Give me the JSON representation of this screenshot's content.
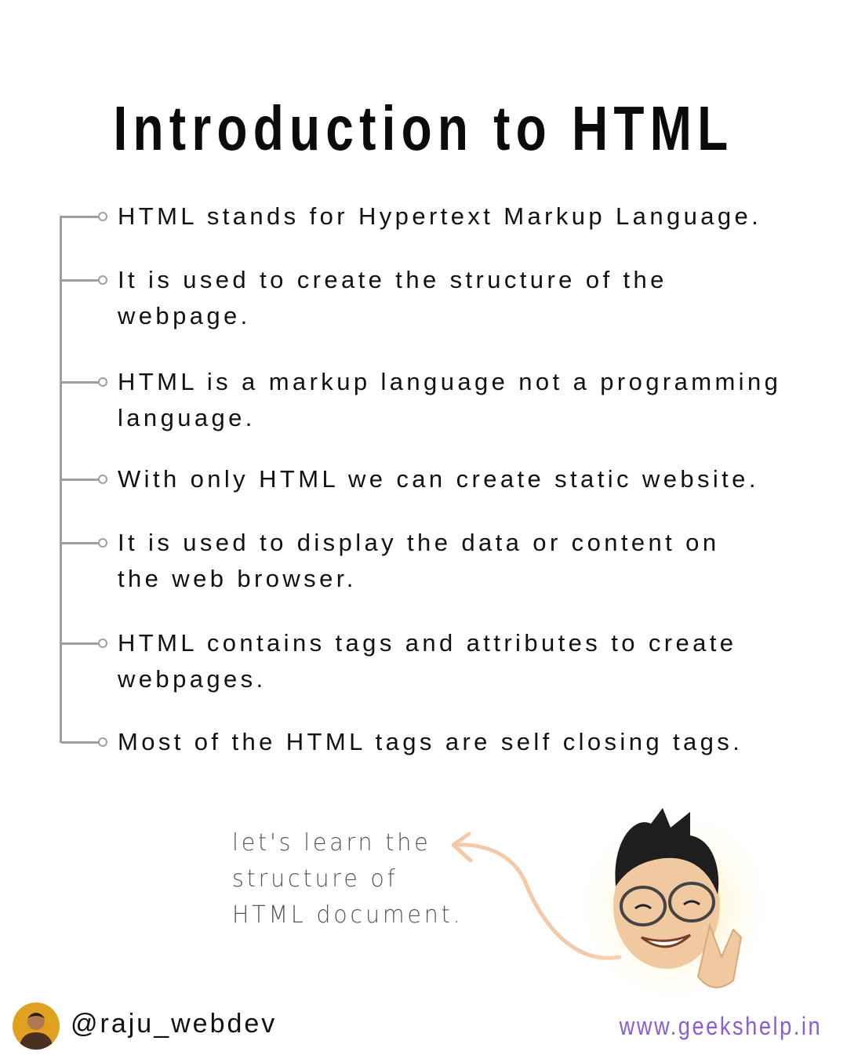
{
  "title": "Introduction to HTML",
  "points": [
    [
      "HTML stands for Hypertext Markup Language."
    ],
    [
      "It is used to create the structure of the",
      "webpage."
    ],
    [
      "HTML is a markup language not a programming",
      "language."
    ],
    [
      "With only HTML we can create static website."
    ],
    [
      "It is used to display the data or content on",
      "the web browser."
    ],
    [
      "HTML contains tags and attributes to create",
      "webpages."
    ],
    [
      "Most of the HTML tags are self closing tags."
    ]
  ],
  "note": [
    "let's learn the",
    "structure of",
    "HTML document."
  ],
  "footer": {
    "handle": "@raju_webdev",
    "website": "www.geekshelp.in"
  },
  "colors": {
    "accent": "#8a5cd6",
    "timeline": "#9e9e9e",
    "arrow": "#f5c9a8"
  }
}
